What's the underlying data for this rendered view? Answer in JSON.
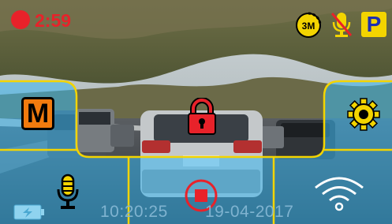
{
  "status": {
    "recording_time": "2:59",
    "record_indicator_color": "#e8222a"
  },
  "top_icons": {
    "loop_label": "3M",
    "parking_label": "P",
    "mic_muted": true
  },
  "menu_button_label": "M",
  "footer": {
    "time": "10:20:25",
    "date": "19-04-2017"
  },
  "colors": {
    "overlay": "#38b6f0",
    "border": "#f3d400",
    "accent_red": "#e8222a",
    "menu_orange": "#f27b0e"
  },
  "icons": [
    "record-dot",
    "loop-timer-icon",
    "mic-muted-icon",
    "parking-icon",
    "menu-icon",
    "lock-icon",
    "settings-gear-icon",
    "charging-icon",
    "microphone-icon",
    "stop-record-icon",
    "wifi-icon"
  ]
}
